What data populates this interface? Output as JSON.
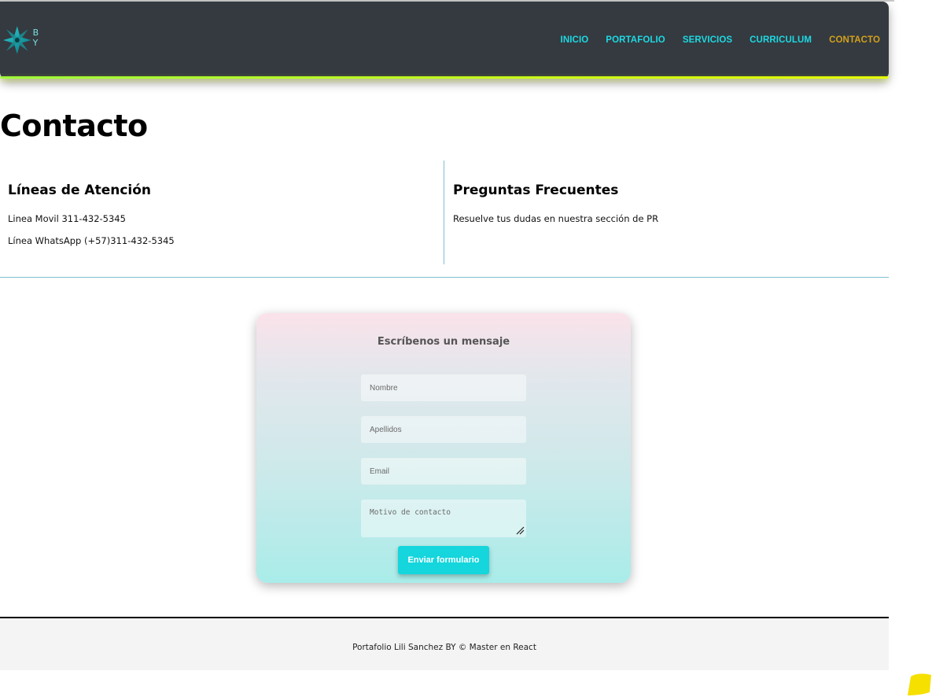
{
  "brand": {
    "logo_text": "B Y",
    "logo_icon": "star-logo-icon"
  },
  "nav": {
    "items": [
      {
        "label": "INICIO"
      },
      {
        "label": "PORTAFOLIO"
      },
      {
        "label": "SERVICIOS"
      },
      {
        "label": "CURRICULUM"
      },
      {
        "label": "CONTACTO"
      }
    ],
    "active_color": "#d4a01c",
    "link_color": "#1fd8e2"
  },
  "page": {
    "title": "Contacto"
  },
  "info": {
    "left": {
      "heading": "Líneas de Atención",
      "lines": [
        "Linea Movil 311-432-5345",
        "Línea WhatsApp (+57)311-432-5345"
      ]
    },
    "right": {
      "heading": "Preguntas Frecuentes",
      "lines": [
        "Resuelve tus dudas en nuestra sección de PR"
      ]
    }
  },
  "form": {
    "title": "Escríbenos un mensaje",
    "fields": {
      "nombre": {
        "placeholder": "Nombre"
      },
      "apellidos": {
        "placeholder": "Apellidos"
      },
      "email": {
        "placeholder": "Email"
      },
      "motivo": {
        "placeholder": "Motivo de contacto"
      }
    },
    "submit_label": "Enviar formulario",
    "accent_color": "#14d6dc"
  },
  "footer": {
    "text": "Portafolio Lili Sanchez BY © Master en React"
  }
}
